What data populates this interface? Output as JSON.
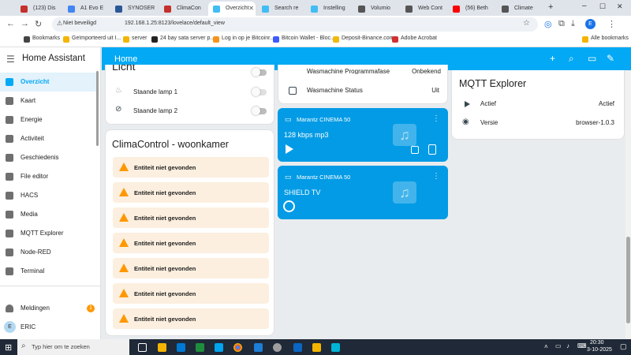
{
  "browser": {
    "tabs": [
      {
        "label": "(123) Dis",
        "color": "#c4302b"
      },
      {
        "label": "A1 Evo E",
        "color": "#4285f4"
      },
      {
        "label": "SYNOSER",
        "color": "#2b5797"
      },
      {
        "label": "ClimaCon",
        "color": "#c4302b"
      },
      {
        "label": "Overzicht",
        "color": "#41bdf5"
      },
      {
        "label": "Search re",
        "color": "#41bdf5"
      },
      {
        "label": "Instelling",
        "color": "#41bdf5"
      },
      {
        "label": "Volumio",
        "color": "#555555"
      },
      {
        "label": "Web Cont",
        "color": "#555555"
      },
      {
        "label": "(56) Beth",
        "color": "#ff0000"
      },
      {
        "label": "Climate",
        "color": "#555555"
      }
    ],
    "security_label": "Niet beveiligd",
    "url": "192.168.1.25:8123/lovelace/default_view",
    "profile_initial": "E",
    "bookmarks": [
      {
        "label": "Bookmarks",
        "color": "#444444"
      },
      {
        "label": "Geïmporteerd uit I...",
        "color": "#f4b400"
      },
      {
        "label": "server",
        "color": "#f4b400"
      },
      {
        "label": "24 bay sata server p...",
        "color": "#222222"
      },
      {
        "label": "Log in op je Bitcoinr...",
        "color": "#f7931a"
      },
      {
        "label": "Bitcoin Wallet - Bloc...",
        "color": "#3d5afe"
      },
      {
        "label": "Deposit-Binance.com",
        "color": "#f0b90b"
      },
      {
        "label": "Adobe Acrobat",
        "color": "#d32f2f"
      }
    ],
    "all_bookmarks": "Alle bookmarks"
  },
  "sidebar": {
    "title": "Home Assistant",
    "items": [
      {
        "label": "Overzicht",
        "icon": "dashboard-icon"
      },
      {
        "label": "Kaart",
        "icon": "map-icon"
      },
      {
        "label": "Energie",
        "icon": "lightning-icon"
      },
      {
        "label": "Activiteit",
        "icon": "list-icon"
      },
      {
        "label": "Geschiedenis",
        "icon": "chart-icon"
      },
      {
        "label": "File editor",
        "icon": "wrench-icon"
      },
      {
        "label": "HACS",
        "icon": "hacs-icon"
      },
      {
        "label": "Media",
        "icon": "media-icon"
      },
      {
        "label": "MQTT Explorer",
        "icon": "broadcast-icon"
      },
      {
        "label": "Node-RED",
        "icon": "sitemap-icon"
      },
      {
        "label": "Terminal",
        "icon": "console-icon"
      }
    ],
    "notifications_label": "Meldingen",
    "notifications_count": "1",
    "user_initial": "E",
    "user_name": "ERIC"
  },
  "header": {
    "title": "Home"
  },
  "lights_card": {
    "title": "Licht",
    "rows": [
      {
        "label": "Staande lamp 1"
      },
      {
        "label": "Staande lamp 2"
      }
    ]
  },
  "clima_card": {
    "title": "ClimaControl - woonkamer",
    "warnings": [
      "Entiteit niet gevonden",
      "Entiteit niet gevonden",
      "Entiteit niet gevonden",
      "Entiteit niet gevonden",
      "Entiteit niet gevonden",
      "Entiteit niet gevonden",
      "Entiteit niet gevonden"
    ]
  },
  "washer_card": {
    "rows": [
      {
        "label": "Wasmachine Programmafase",
        "value": "Onbekend"
      },
      {
        "label": "Wasmachine Status",
        "value": "Uit"
      }
    ]
  },
  "media1": {
    "name": "Marantz CINEMA 50",
    "title": "128 kbps mp3"
  },
  "media2": {
    "name": "Marantz CINEMA 50",
    "title": "SHIELD TV"
  },
  "mqtt_card": {
    "title": "MQTT Explorer",
    "rows": [
      {
        "label": "Actief",
        "value": "Actief"
      },
      {
        "label": "Versie",
        "value": "browser-1.0.3"
      }
    ]
  },
  "taskbar": {
    "search_placeholder": "Typ hier om te zoeken",
    "time": "20:30",
    "date": "3-10-2025"
  },
  "colors": {
    "accent": "#03a9f4",
    "media_card": "#039be5",
    "warning": "#ff9800"
  }
}
